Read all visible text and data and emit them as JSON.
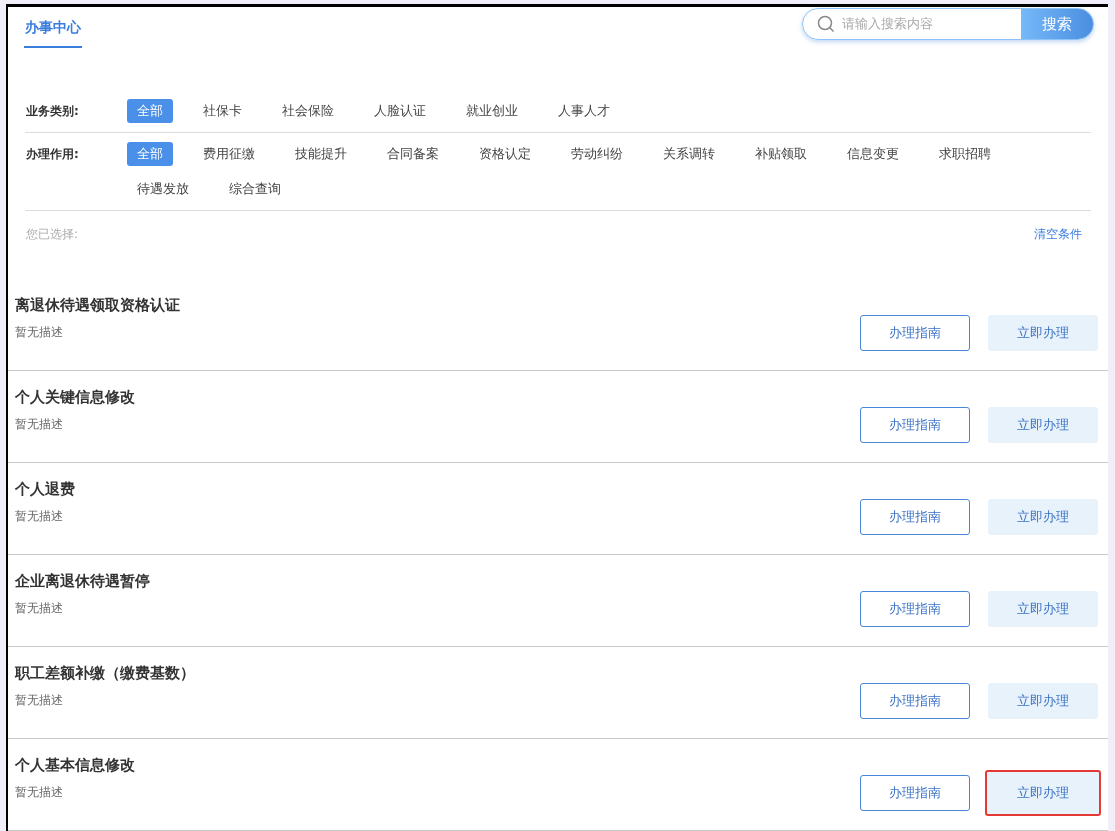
{
  "header": {
    "title": "办事中心",
    "search": {
      "placeholder": "请输入搜索内容",
      "button": "搜索"
    }
  },
  "filters": [
    {
      "label": "业务类别:",
      "options": [
        {
          "label": "全部",
          "selected": true
        },
        {
          "label": "社保卡",
          "selected": false
        },
        {
          "label": "社会保险",
          "selected": false
        },
        {
          "label": "人脸认证",
          "selected": false
        },
        {
          "label": "就业创业",
          "selected": false
        },
        {
          "label": "人事人才",
          "selected": false
        }
      ]
    },
    {
      "label": "办理作用:",
      "options": [
        {
          "label": "全部",
          "selected": true
        },
        {
          "label": "费用征缴",
          "selected": false
        },
        {
          "label": "技能提升",
          "selected": false
        },
        {
          "label": "合同备案",
          "selected": false
        },
        {
          "label": "资格认定",
          "selected": false
        },
        {
          "label": "劳动纠纷",
          "selected": false
        },
        {
          "label": "关系调转",
          "selected": false
        },
        {
          "label": "补贴领取",
          "selected": false
        },
        {
          "label": "信息变更",
          "selected": false
        },
        {
          "label": "求职招聘",
          "selected": false
        },
        {
          "label": "待遇发放",
          "selected": false
        },
        {
          "label": "综合查询",
          "selected": false
        }
      ]
    }
  ],
  "selected_bar": {
    "label": "您已选择:",
    "clear": "清空条件"
  },
  "services": [
    {
      "title": "离退休待遇领取资格认证",
      "description": "暂无描述",
      "guide_button": "办理指南",
      "apply_button": "立即办理",
      "highlighted": false
    },
    {
      "title": "个人关键信息修改",
      "description": "暂无描述",
      "guide_button": "办理指南",
      "apply_button": "立即办理",
      "highlighted": false
    },
    {
      "title": "个人退费",
      "description": "暂无描述",
      "guide_button": "办理指南",
      "apply_button": "立即办理",
      "highlighted": false
    },
    {
      "title": "企业离退休待遇暂停",
      "description": "暂无描述",
      "guide_button": "办理指南",
      "apply_button": "立即办理",
      "highlighted": false
    },
    {
      "title": "职工差额补缴（缴费基数）",
      "description": "暂无描述",
      "guide_button": "办理指南",
      "apply_button": "立即办理",
      "highlighted": false
    },
    {
      "title": "个人基本信息修改",
      "description": "暂无描述",
      "guide_button": "办理指南",
      "apply_button": "立即办理",
      "highlighted": true
    }
  ]
}
